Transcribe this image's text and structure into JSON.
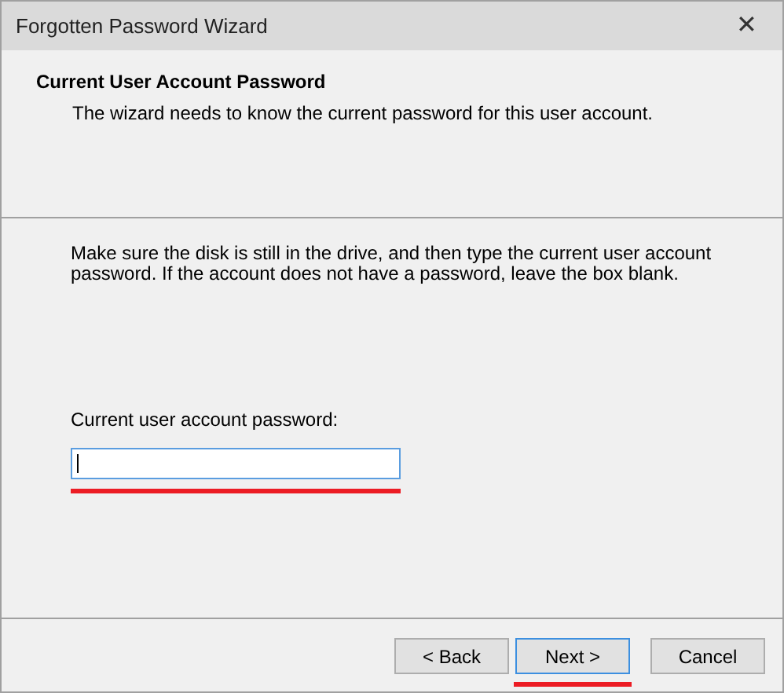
{
  "window": {
    "title": "Forgotten Password Wizard",
    "close_glyph": "✕"
  },
  "header": {
    "title": "Current User Account Password",
    "subtitle": "The wizard needs to know the current password for this user account."
  },
  "instructions": "Make sure the disk is still in the drive, and then type the current user account password. If the account does not have a password, leave the box blank.",
  "password_field": {
    "label": "Current user account password:",
    "focused": true,
    "highlighted": true
  },
  "buttons": [
    {
      "label": "< Back",
      "focused": false,
      "highlighted": false
    },
    {
      "label": "Next >",
      "focused": true,
      "highlighted": true
    },
    {
      "label": "Cancel",
      "focused": false,
      "highlighted": false
    }
  ]
}
